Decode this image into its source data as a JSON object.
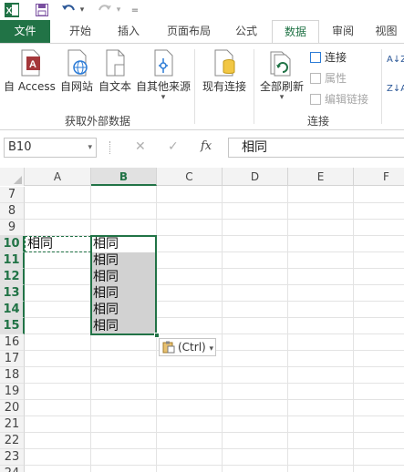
{
  "quick_access": {
    "undo_arrow": "▾",
    "redo_arrow": "▾",
    "customize": "="
  },
  "tabs": [
    "文件",
    "开始",
    "插入",
    "页面布局",
    "公式",
    "数据",
    "审阅",
    "视图"
  ],
  "active_tab": "数据",
  "ribbon": {
    "get_external": {
      "buttons": [
        "自 Access",
        "自网站",
        "自文本",
        "自其他来源"
      ],
      "other_dropdown": "▾",
      "label": "获取外部数据"
    },
    "existing_connections": "现有连接",
    "connections": {
      "refresh_all": "全部刷新",
      "refresh_dropdown": "▾",
      "connections": "连接",
      "properties": "属性",
      "edit_links": "编辑链接",
      "label": "连接"
    },
    "sort_az": "A↓Z",
    "sort_za": "Z↓A"
  },
  "formula_bar": {
    "name_box": "B10",
    "name_box_dropdown": "▾",
    "cancel": "✕",
    "enter": "✓",
    "fx": "fx",
    "value": "相同"
  },
  "columns": [
    "A",
    "B",
    "C",
    "D",
    "E",
    "F"
  ],
  "selected_column": "B",
  "rows": [
    "7",
    "8",
    "9",
    "10",
    "11",
    "12",
    "13",
    "14",
    "15",
    "16",
    "17",
    "18",
    "19",
    "20",
    "21",
    "22",
    "23",
    "24"
  ],
  "selected_rows": [
    "10",
    "11",
    "12",
    "13",
    "14",
    "15"
  ],
  "cells": {
    "A10": "相同",
    "B10": "相同",
    "B11": "相同",
    "B12": "相同",
    "B13": "相同",
    "B14": "相同",
    "B15": "相同"
  },
  "paste_options": "(Ctrl)",
  "paste_dropdown": "▾",
  "colors": {
    "accent": "#217346",
    "fill_gray": "#d2d2d2"
  }
}
